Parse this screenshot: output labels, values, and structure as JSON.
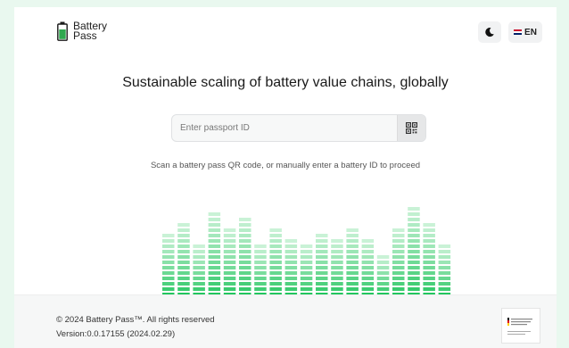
{
  "header": {
    "logo_line1": "Battery",
    "logo_line2": "Pass",
    "language_label": "EN"
  },
  "hero": {
    "headline": "Sustainable scaling of battery value chains, globally",
    "search_placeholder": "Enter passport ID",
    "hint": "Scan a battery pass QR code, or manually enter a battery ID to proceed"
  },
  "equalizer": {
    "bar_levels": [
      12,
      14,
      10,
      16,
      13,
      15,
      10,
      13,
      11,
      10,
      12,
      11,
      13,
      11,
      8,
      13,
      17,
      14,
      10
    ],
    "top_color": "#c9f2d6",
    "base_color": "#22c55e"
  },
  "footer": {
    "copyright": "© 2024 Battery Pass™. All rights reserved",
    "version": "Version:0.0.17155 (2024.02.29)"
  },
  "colors": {
    "background": "#e9f8ef",
    "brand_green": "#2fa84f"
  }
}
